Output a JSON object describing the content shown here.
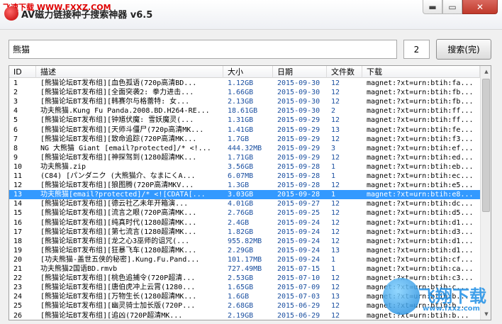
{
  "window": {
    "title": "AV磁力链接种子搜索神器 v6.5",
    "watermark_top": "飞速下载 WWW.FXXZ.COM",
    "min_glyph": "▬",
    "max_glyph": "▭",
    "close_glyph": "✕"
  },
  "search": {
    "query": "熊猫",
    "page": "2",
    "button_label": "搜索(完)"
  },
  "table": {
    "columns": [
      "ID",
      "描述",
      "大小",
      "日期",
      "文件数",
      "下载"
    ],
    "selected_index": 12,
    "rows": [
      [
        "1",
        "[熊猫论坛BT发布组][血色孤语(720p高清BD...",
        "1.12GB",
        "2015-09-30",
        "12",
        "magnet:?xt=urn:btih:fa..."
      ],
      [
        "2",
        "[熊猫论坛BT发布组][全面突袭2: 拳力进击...",
        "1.66GB",
        "2015-09-30",
        "12",
        "magnet:?xt=urn:btih:fb..."
      ],
      [
        "3",
        "[熊猫论坛BT发布组][韩赛尔与格蕾特: 女...",
        "2.13GB",
        "2015-09-30",
        "12",
        "magnet:?xt=urn:btih:fb..."
      ],
      [
        "4",
        "功夫熊猫.Kung Fu Panda.2008.BD.H264-RE...",
        "18.61GB",
        "2015-09-30",
        "2",
        "magnet:?xt=urn:btih:ff..."
      ],
      [
        "5",
        "[熊猫论坛BT发布组][钟馗伏魔: 雪妖魔灵(...",
        "1.31GB",
        "2015-09-29",
        "12",
        "magnet:?xt=urn:btih:ff..."
      ],
      [
        "6",
        "[熊猫论坛BT发布组][天师斗僵尸(720p高清MK...",
        "1.41GB",
        "2015-09-29",
        "13",
        "magnet:?xt=urn:btih:fe..."
      ],
      [
        "7",
        "[熊猫论坛BT发布组][致命追踪(720P高清MK...",
        "1.7GB",
        "2015-09-29",
        "12",
        "magnet:?xt=urn:btih:f3..."
      ],
      [
        "8",
        "NG 大熊猫 Giant [email?protected]/* <!...",
        "444.32MB",
        "2015-09-29",
        "3",
        "magnet:?xt=urn:btih:ef..."
      ],
      [
        "9",
        "[熊猫论坛BT发布组][神探驾到(1280超清MK...",
        "1.71GB",
        "2015-09-29",
        "12",
        "magnet:?xt=urn:btih:ed..."
      ],
      [
        "10",
        "功夫熊猫.zip",
        "3.56GB",
        "2015-09-28",
        "1",
        "magnet:?xt=urn:btih:eb..."
      ],
      [
        "11",
        "(C84) [パンダニク (大熊猫介、なまにくA...",
        "6.07MB",
        "2015-09-28",
        "1",
        "magnet:?xt=urn:btih:ec..."
      ],
      [
        "12",
        "[熊猫论坛BT发布组][狼图腾(720P高清MKV...",
        "1.3GB",
        "2015-09-28",
        "12",
        "magnet:?xt=urn:btih:e5..."
      ],
      [
        "13",
        "功夫熊猫[email?protected]/* <![CDATA[...",
        "3.03GB",
        "2015-09-28",
        "1",
        "magnet:?xt=urn:btih:e8..."
      ],
      [
        "14",
        "[熊猫论坛BT发布组][德云社乙未年开箱演...",
        "4.01GB",
        "2015-09-27",
        "12",
        "magnet:?xt=urn:btih:dc..."
      ],
      [
        "15",
        "[熊猫论坛BT发布组][流言之眼(720P高清MK...",
        "2.76GB",
        "2015-09-25",
        "12",
        "magnet:?xt=urn:btih:d5..."
      ],
      [
        "16",
        "[熊猫论坛BT发布组][纯真时代(1280超清MK...",
        "2.4GB",
        "2015-09-24",
        "12",
        "magnet:?xt=urn:btih:d1..."
      ],
      [
        "17",
        "[熊猫论坛BT发布组][第七流言(1280超清MK...",
        "1.82GB",
        "2015-09-24",
        "12",
        "magnet:?xt=urn:btih:d3..."
      ],
      [
        "18",
        "[熊猫论坛BT发布组][龙之心3巫师的诅咒(...",
        "955.82MB",
        "2015-09-24",
        "12",
        "magnet:?xt=urn:btih:d1..."
      ],
      [
        "19",
        "[熊猫论坛BT发布组][狂暴飞车(1280超清MK...",
        "2.29GB",
        "2015-09-24",
        "13",
        "magnet:?xt=urn:btih:d1..."
      ],
      [
        "20",
        "[功夫熊猫-盖世五侠的秘密].Kung.Fu.Pand...",
        "101.17MB",
        "2015-09-24",
        "1",
        "magnet:?xt=urn:btih:cf..."
      ],
      [
        "21",
        "功夫熊猫2国语BD.rmvb",
        "727.49MB",
        "2015-07-15",
        "1",
        "magnet:?xt=urn:btih:ca..."
      ],
      [
        "22",
        "[熊猫论坛BT发布组][桃色追捕令(720P超清...",
        "2.53GB",
        "2015-07-10",
        "12",
        "magnet:?xt=urn:btih:c3..."
      ],
      [
        "23",
        "[熊猫论坛BT发布组][唐伯虎冲上云霄(1280...",
        "1.65GB",
        "2015-07-09",
        "12",
        "magnet:?xt=urn:btih:c..."
      ],
      [
        "24",
        "[熊猫论坛BT发布组][万物生长(1280超清MK...",
        "1.6GB",
        "2015-07-03",
        "13",
        "magnet:?xt=urn:btih:b..."
      ],
      [
        "25",
        "[熊猫论坛BT发布组][幽灵骑士加长版(720P...",
        "2.68GB",
        "2015-06-29",
        "12",
        "magnet:?xt=urn:btih:b..."
      ],
      [
        "26",
        "[熊猫论坛BT发布组][追凶(720P超清MK...",
        "2.19GB",
        "2015-06-29",
        "12",
        "magnet:?xt=urn:btih:b..."
      ]
    ]
  },
  "watermark": {
    "logo_text": "飞翔下载",
    "url": "www.fxxz.com"
  }
}
